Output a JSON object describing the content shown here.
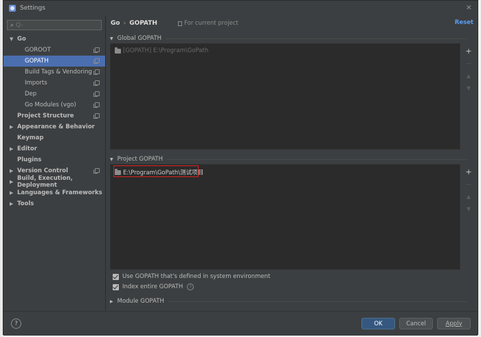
{
  "window": {
    "title": "Settings",
    "close_glyph": "×"
  },
  "sidebar": {
    "search_placeholder": "Q-",
    "items": [
      {
        "label": "Go",
        "level": 0,
        "expanded": true,
        "has_copy": false
      },
      {
        "label": "GOROOT",
        "level": 1,
        "has_copy": true
      },
      {
        "label": "GOPATH",
        "level": 1,
        "has_copy": true,
        "selected": true
      },
      {
        "label": "Build Tags & Vendoring",
        "level": 1,
        "has_copy": true
      },
      {
        "label": "Imports",
        "level": 1,
        "has_copy": true
      },
      {
        "label": "Dep",
        "level": 1,
        "has_copy": true
      },
      {
        "label": "Go Modules (vgo)",
        "level": 1,
        "has_copy": true
      },
      {
        "label": "Project Structure",
        "level": 0,
        "has_copy": true
      },
      {
        "label": "Appearance & Behavior",
        "level": 0,
        "collapsed": true
      },
      {
        "label": "Keymap",
        "level": 0
      },
      {
        "label": "Editor",
        "level": 0,
        "collapsed": true
      },
      {
        "label": "Plugins",
        "level": 0
      },
      {
        "label": "Version Control",
        "level": 0,
        "collapsed": true,
        "has_copy": true
      },
      {
        "label": "Build, Execution, Deployment",
        "level": 0,
        "collapsed": true
      },
      {
        "label": "Languages & Frameworks",
        "level": 0,
        "collapsed": true
      },
      {
        "label": "Tools",
        "level": 0,
        "collapsed": true
      }
    ]
  },
  "header": {
    "crumb_root": "Go",
    "crumb_sep": "›",
    "crumb_current": "GOPATH",
    "project_note": "For current project",
    "reset": "Reset"
  },
  "global_gopath": {
    "title": "Global GOPATH",
    "entry": "[GOPATH] E:\\Program\\GoPath"
  },
  "project_gopath": {
    "title": "Project GOPATH",
    "entry": "E:\\Program\\GoPath\\测试项目"
  },
  "options": {
    "use_system_gopath": "Use GOPATH that's defined in system environment",
    "index_entire_gopath": "Index entire GOPATH"
  },
  "module_gopath": {
    "title": "Module GOPATH"
  },
  "footer": {
    "ok": "OK",
    "cancel": "Cancel",
    "apply": "Apply",
    "help": "?"
  },
  "colors": {
    "selection": "#4b6eaf",
    "accent_link": "#589df6",
    "highlight_box": "#e02020",
    "ok_button": "#365880"
  }
}
